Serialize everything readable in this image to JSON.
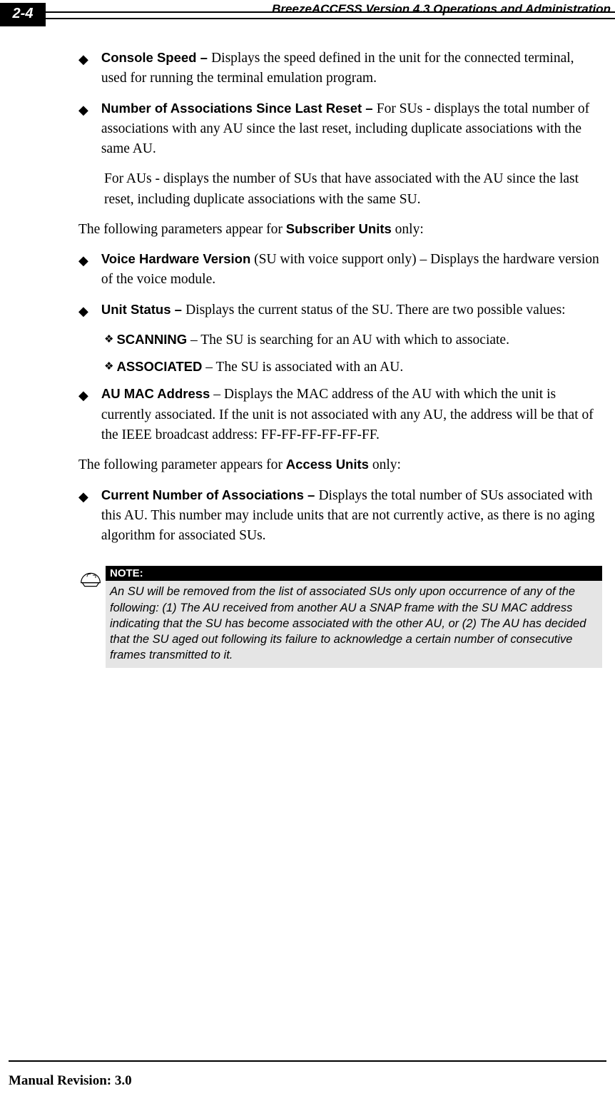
{
  "header": {
    "page_number": "2-4",
    "title": "BreezeACCESS Version 4.3 Operations and Administration"
  },
  "items": {
    "console_speed": {
      "label": "Console Speed – ",
      "text": "Displays the speed defined in the unit for the connected terminal, used for running the terminal emulation program."
    },
    "num_assoc": {
      "label": "Number of Associations Since Last Reset – ",
      "text": "For SUs - displays the total number of associations with any AU since the last reset, including duplicate associations with the same AU.",
      "para2": "For AUs - displays the number of SUs that have associated with the AU since the last reset, including duplicate associations with the same SU."
    },
    "su_intro_pre": "The following parameters appear for ",
    "su_intro_bold": "Subscriber Units",
    "su_intro_post": " only:",
    "voice_hw": {
      "label": "Voice Hardware Version",
      "text": " (SU with voice support only) – Displays the hardware version of the voice module."
    },
    "unit_status": {
      "label": "Unit Status – ",
      "text": "Displays the current status of the SU. There are two possible values:"
    },
    "scanning": {
      "label": "SCANNING",
      "text": " – The SU is searching for an AU with which to associate."
    },
    "associated": {
      "label": "ASSOCIATED",
      "text": " – The SU is associated with an AU."
    },
    "au_mac": {
      "label": "AU MAC Address",
      "text": " – Displays the MAC address of the AU with which the unit is currently associated. If the unit is not associated with any AU, the address will be that of the IEEE broadcast address: FF-FF-FF-FF-FF-FF."
    },
    "au_intro_pre": "The following parameter appears for ",
    "au_intro_bold": "Access Units",
    "au_intro_post": " only:",
    "current_num": {
      "label": "Current Number of Associations – ",
      "text": "Displays the total number of SUs associated with this AU. This number may include units that are not currently active, as there is no aging algorithm for associated SUs."
    }
  },
  "note": {
    "header": "NOTE:",
    "body": "An SU will be removed from the list of associated SUs only upon occurrence of any of the following: (1) The AU received from another AU a SNAP frame with the SU MAC address indicating that the SU has become associated with the other AU, or (2) The AU has decided that the SU aged out following its failure to acknowledge a certain number of consecutive frames transmitted to it."
  },
  "footer": {
    "text": "Manual Revision: 3.0"
  }
}
